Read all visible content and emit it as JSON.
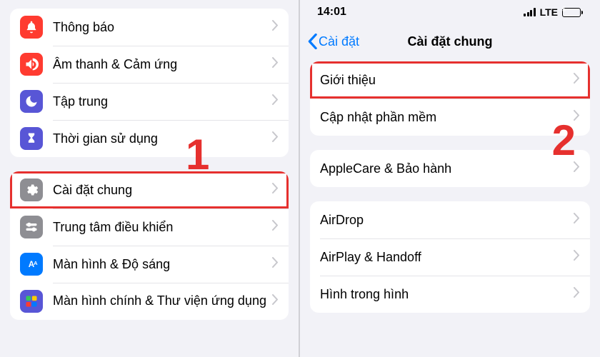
{
  "status": {
    "time": "14:01",
    "network": "LTE",
    "battery_level": "5"
  },
  "left": {
    "group1": [
      {
        "label": "Thông báo"
      },
      {
        "label": "Âm thanh & Cảm ứng"
      },
      {
        "label": "Tập trung"
      },
      {
        "label": "Thời gian sử dụng"
      }
    ],
    "group2": [
      {
        "label": "Cài đặt chung"
      },
      {
        "label": "Trung tâm điều khiển"
      },
      {
        "label": "Màn hình & Độ sáng"
      },
      {
        "label": "Màn hình chính & Thư viện ứng dụng"
      }
    ],
    "annotation": "1"
  },
  "right": {
    "back_label": "Cài đặt",
    "title": "Cài đặt chung",
    "group1": [
      {
        "label": "Giới thiệu"
      },
      {
        "label": "Cập nhật phần mềm"
      }
    ],
    "group2": [
      {
        "label": "AppleCare & Bảo hành"
      }
    ],
    "group3": [
      {
        "label": "AirDrop"
      },
      {
        "label": "AirPlay & Handoff"
      },
      {
        "label": "Hình trong hình"
      }
    ],
    "annotation": "2"
  }
}
